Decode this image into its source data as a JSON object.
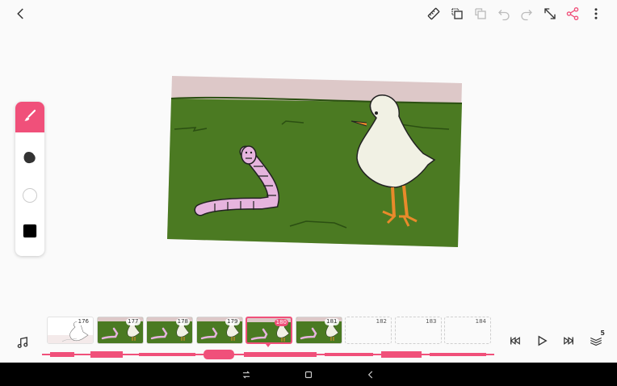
{
  "app": {
    "accent": "#f0507a"
  },
  "toolbar": {
    "icons": [
      "back-arrow-icon",
      "ruler-icon",
      "copy-frame-icon",
      "paste-frame-icon",
      "undo-icon",
      "redo-icon",
      "resize-icon",
      "share-icon",
      "more-vert-icon"
    ]
  },
  "palette": {
    "tools": [
      "brush-icon",
      "eraser-icon"
    ],
    "colors": [
      "#ffffff",
      "#000000"
    ]
  },
  "timeline": {
    "frames": [
      {
        "num": "176",
        "state": "filled"
      },
      {
        "num": "177",
        "state": "filled"
      },
      {
        "num": "178",
        "state": "filled"
      },
      {
        "num": "179",
        "state": "filled"
      },
      {
        "num": "180",
        "state": "current"
      },
      {
        "num": "181",
        "state": "filled"
      },
      {
        "num": "182",
        "state": "empty"
      },
      {
        "num": "183",
        "state": "empty"
      },
      {
        "num": "184",
        "state": "empty"
      }
    ],
    "layers_count": "5"
  },
  "colors": {
    "grass": "#4b7a22",
    "sky": "#ddc8c8",
    "worm": "#e6b4de",
    "duck": "#f1f1e4",
    "beak": "#e98a2b"
  }
}
